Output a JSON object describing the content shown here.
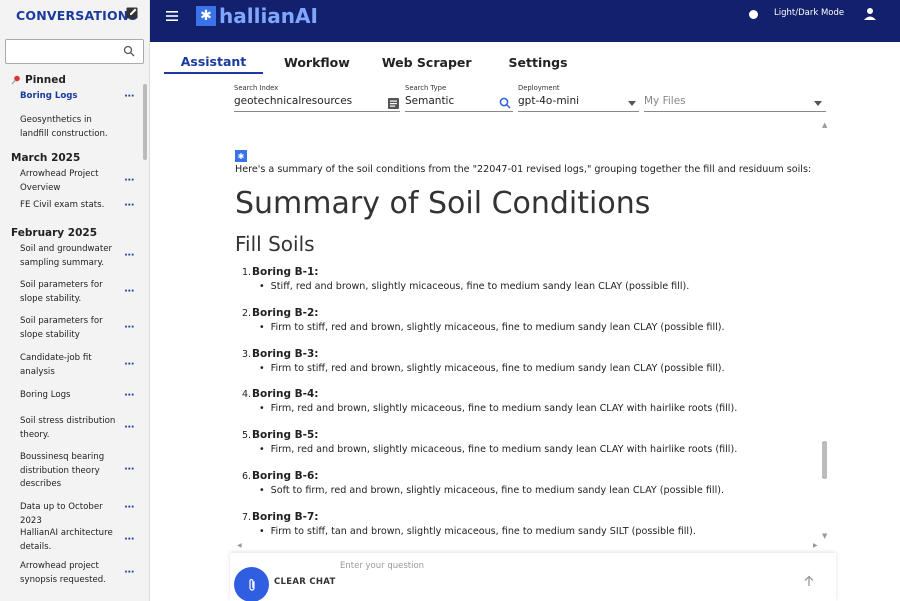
{
  "sidebar": {
    "title": "CONVERSATIONS",
    "search_placeholder": "",
    "sections": [
      {
        "label": "Pinned",
        "items": [
          {
            "label": "Boring Logs",
            "active": true
          },
          {
            "label": "Geosynthetics in landfill construction.",
            "active": false
          }
        ]
      },
      {
        "label": "March 2025",
        "items": [
          {
            "label": "Arrowhead Project Overview"
          },
          {
            "label": "FE Civil exam stats."
          }
        ]
      },
      {
        "label": "February 2025",
        "items": [
          {
            "label": "Soil and groundwater sampling summary."
          },
          {
            "label": "Soil parameters for slope stability."
          },
          {
            "label": "Soil parameters for slope stability"
          },
          {
            "label": "Candidate-job fit analysis"
          },
          {
            "label": "Boring Logs"
          },
          {
            "label": "Soil stress distribution theory."
          },
          {
            "label": "Boussinesq bearing distribution theory describes"
          },
          {
            "label": "Data up to October 2023"
          },
          {
            "label": "HallianAI architecture details."
          },
          {
            "label": "Arrowhead project synopsis requested."
          }
        ]
      }
    ],
    "more_label": "···"
  },
  "header": {
    "logo_text": "hallianAI",
    "theme_toggle_label": "Light/Dark Mode"
  },
  "tabs": [
    "Assistant",
    "Workflow",
    "Web Scraper",
    "Settings"
  ],
  "fields": {
    "search_index": {
      "label": "Search Index",
      "value": "geotechnicalresources"
    },
    "search_type": {
      "label": "Search Type",
      "value": "Semantic"
    },
    "deployment": {
      "label": "Deployment",
      "value": "gpt-4o-mini"
    },
    "my_files": {
      "placeholder": "My Files"
    }
  },
  "message": {
    "intro": "Here's a summary of the soil conditions from the \"22047-01 revised logs,\" grouping together the fill and residuum soils:",
    "heading": "Summary of Soil Conditions",
    "subheading": "Fill Soils",
    "borings": [
      {
        "num": "1.",
        "title": "Boring B-1:",
        "desc": "Stiff, red and brown, slightly micaceous, fine to medium sandy lean CLAY (possible fill)."
      },
      {
        "num": "2.",
        "title": "Boring B-2:",
        "desc": "Firm to stiff, red and brown, slightly micaceous, fine to medium sandy lean CLAY (possible fill)."
      },
      {
        "num": "3.",
        "title": "Boring B-3:",
        "desc": "Firm to stiff, red and brown, slightly micaceous, fine to medium sandy lean CLAY (possible fill)."
      },
      {
        "num": "4.",
        "title": "Boring B-4:",
        "desc": "Firm, red and brown, slightly micaceous, fine to medium sandy lean CLAY with hairlike roots (fill)."
      },
      {
        "num": "5.",
        "title": "Boring B-5:",
        "desc": "Firm, red and brown, slightly micaceous, fine to medium sandy lean CLAY with hairlike roots (fill)."
      },
      {
        "num": "6.",
        "title": "Boring B-6:",
        "desc": "Soft to firm, red and brown, slightly micaceous, fine to medium sandy lean CLAY (possible fill)."
      },
      {
        "num": "7.",
        "title": "Boring B-7:",
        "desc": "Firm to stiff, tan and brown, slightly micaceous, fine to medium sandy SILT (possible fill)."
      }
    ]
  },
  "input": {
    "placeholder": "Enter your question",
    "clear_label": "CLEAR CHAT"
  },
  "colors": {
    "topbar": "#13206b",
    "accent": "#1a3a9e",
    "attach_button": "#2f5ee0"
  }
}
